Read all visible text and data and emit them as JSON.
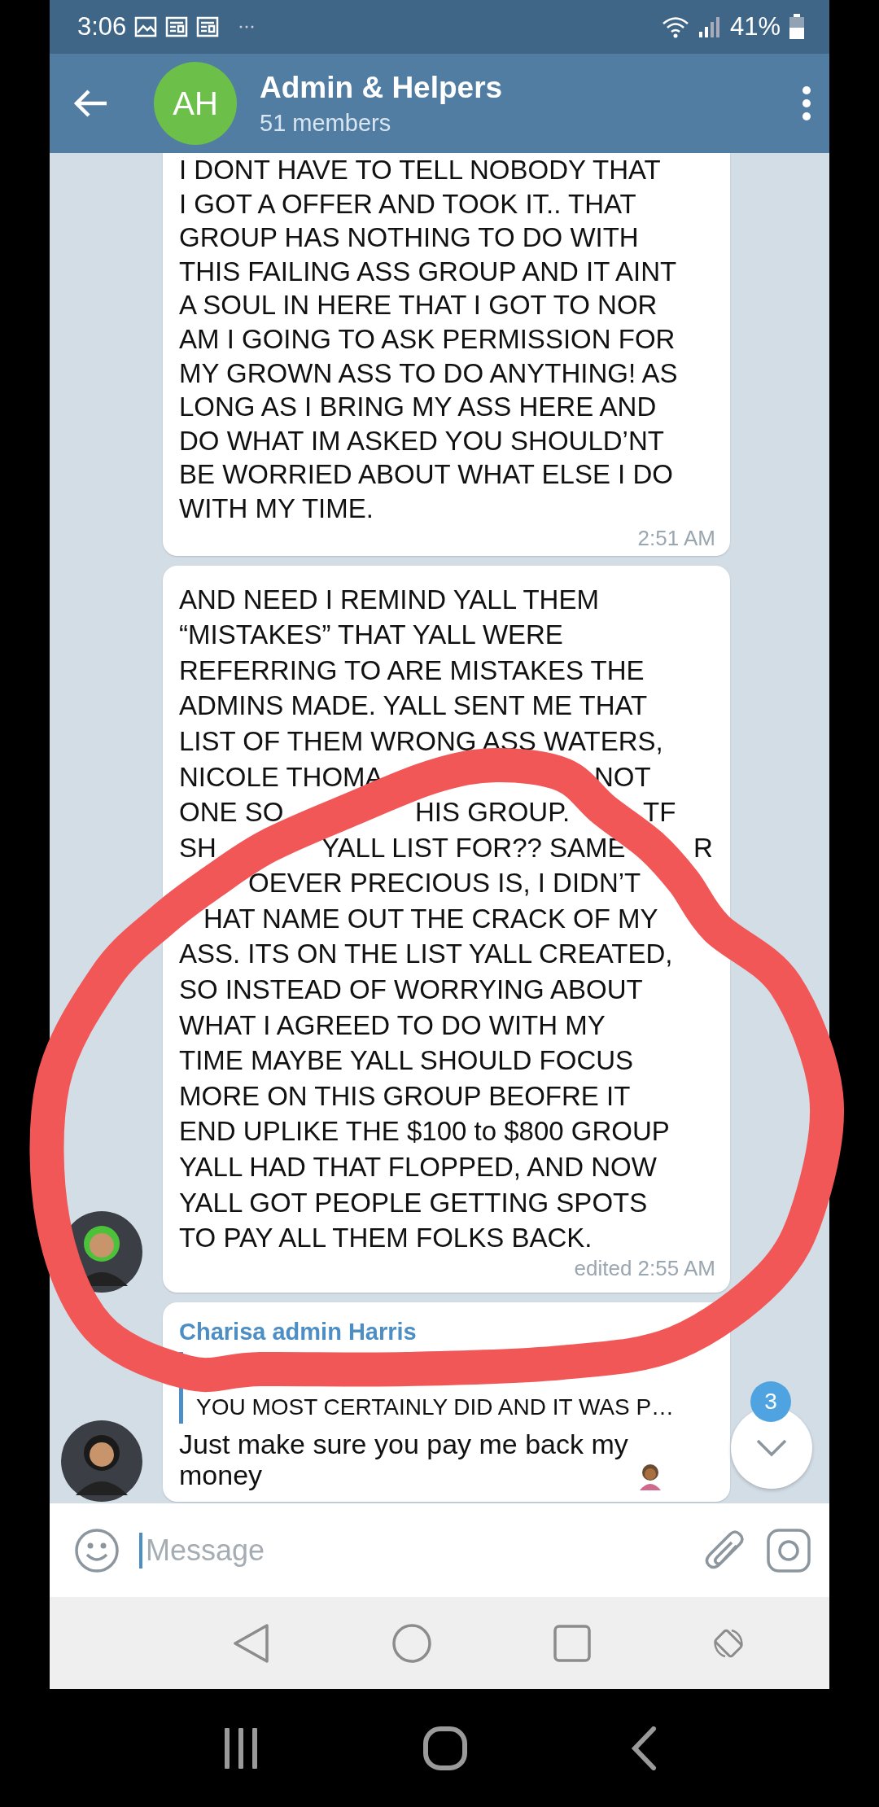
{
  "status_bar": {
    "time": "3:06",
    "battery": "41%"
  },
  "header": {
    "avatar_initials": "AH",
    "title": "Admin & Helpers",
    "subtitle": "51 members"
  },
  "messages": [
    {
      "kind": "text",
      "avatar": false,
      "lines": [
        "I DONT HAVE TO TELL NOBODY THAT",
        "I GOT A OFFER AND TOOK IT.. THAT",
        "GROUP HAS NOTHING TO DO WITH",
        "THIS FAILING ASS GROUP AND IT AINT",
        "A SOUL IN HERE THAT I GOT TO NOR",
        "AM I GOING TO ASK PERMISSION FOR",
        "MY GROWN ASS TO DO ANYTHING! AS",
        "LONG AS I BRING MY ASS HERE AND",
        "DO WHAT IM ASKED YOU SHOULD’NT",
        "BE WORRIED ABOUT WHAT ELSE I DO",
        "WITH MY TIME."
      ],
      "time": "2:51 AM"
    },
    {
      "kind": "covered",
      "avatar": true,
      "lines": [
        [
          "AND NEED I REMIND YALL THEM"
        ],
        [
          "“MISTAKES” THAT YALL WERE"
        ],
        [
          "REFERRING TO ARE MISTAKES THE"
        ],
        [
          "ADMINS MADE. YALL SENT ME THAT"
        ],
        [
          "LIST OF THEM WRONG ASS WATERS,"
        ],
        [
          "NICOLE THOMA",
          "NOT"
        ],
        [
          "ONE SO",
          "HIS GROUP.",
          "TF"
        ],
        [
          "SH",
          "YALL LIST FOR?? SAME",
          "R"
        ],
        [
          "OEVER PRECIOUS IS, I DIDN’T"
        ],
        [
          "HAT NAME OUT THE CRACK OF MY"
        ],
        [
          "ASS. ITS ON THE LIST YALL CREATED,"
        ],
        [
          "SO INSTEAD OF WORRYING ABOUT"
        ],
        [
          "WHAT I AGREED TO DO WITH MY"
        ],
        [
          "TIME MAYBE YALL SHOULD FOCUS"
        ],
        [
          "MORE ON THIS GROUP BEOFRE IT"
        ],
        [
          "END UPLIKE THE $100 to $800 GROUP"
        ],
        [
          "YALL HAD THAT FLOPPED, AND NOW"
        ],
        [
          "YALL GOT PEOPLE GETTING SPOTS"
        ],
        [
          "TO PAY ALL THEM FOLKS BACK."
        ]
      ],
      "time": "edited 2:55 AM"
    },
    {
      "kind": "reply",
      "avatar": true,
      "sender": "Charisa admin Harris",
      "quote": "YOU MOST CERTAINLY DID AND IT WAS P…",
      "lines": [
        "Just make sure you pay me back my",
        "money"
      ]
    }
  ],
  "scroll_button": {
    "badge": "3"
  },
  "composer": {
    "placeholder": "Message"
  }
}
